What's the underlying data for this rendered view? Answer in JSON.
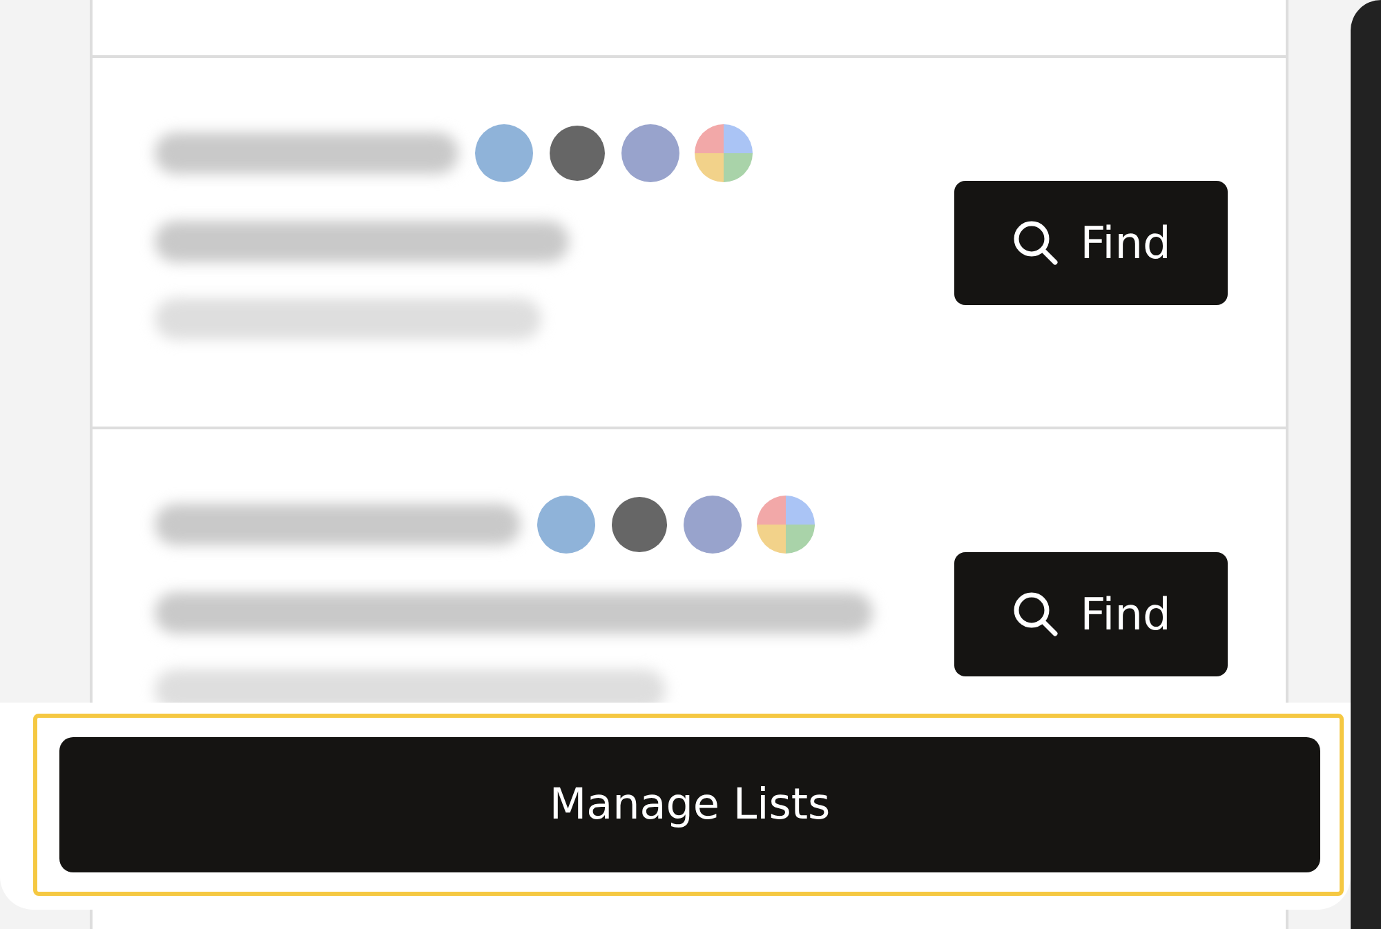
{
  "contacts": [
    {
      "find_button": "Find"
    },
    {
      "find_button": "Find"
    }
  ],
  "manage_button": "Manage Lists"
}
